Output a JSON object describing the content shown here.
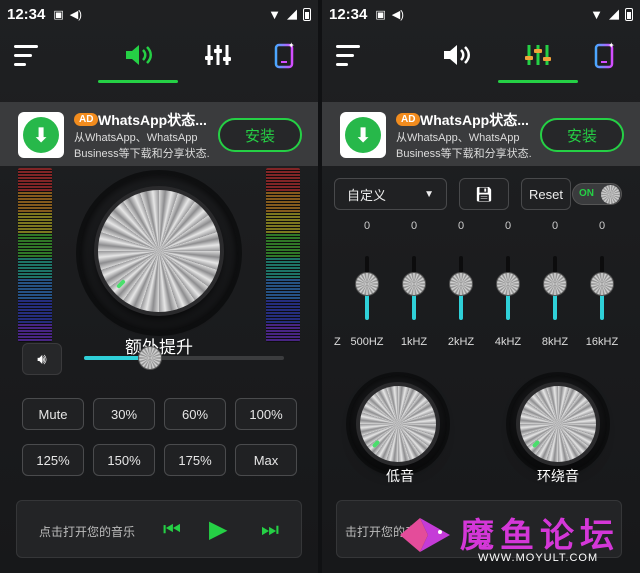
{
  "status": {
    "time": "12:34"
  },
  "ad": {
    "tag": "AD",
    "title": "WhatsApp状态...",
    "desc_line1": "从WhatsApp、WhatsApp",
    "desc_line2": "Business等下载和分享状态...",
    "install_label": "安装"
  },
  "left": {
    "boost_label": "额外提升",
    "boost_value": 0.33,
    "presets": [
      "Mute",
      "30%",
      "60%",
      "100%",
      "125%",
      "150%",
      "175%",
      "Max"
    ],
    "player_text": "点击打开您的音乐",
    "active_tab": "volume"
  },
  "right": {
    "preset_name": "自定义",
    "reset_label": "Reset",
    "toggle_label": "ON",
    "bands": [
      {
        "value": "0",
        "freq": "500HZ"
      },
      {
        "value": "0",
        "freq": "1kHZ"
      },
      {
        "value": "0",
        "freq": "2kHZ"
      },
      {
        "value": "0",
        "freq": "4kHZ"
      },
      {
        "value": "0",
        "freq": "8kHZ"
      },
      {
        "value": "0",
        "freq": "16kHZ"
      }
    ],
    "partial_freq": "Z",
    "bass_label": "低音",
    "surround_label": "环绕音",
    "player_text": "击打开您的音",
    "active_tab": "equalizer"
  },
  "watermark": {
    "title": "魔鱼论坛",
    "url": "WWW.MOYULT.COM"
  },
  "colors": {
    "accent": "#25d045",
    "cyan": "#2fd0d8",
    "ad_tag": "#f28c1e"
  }
}
